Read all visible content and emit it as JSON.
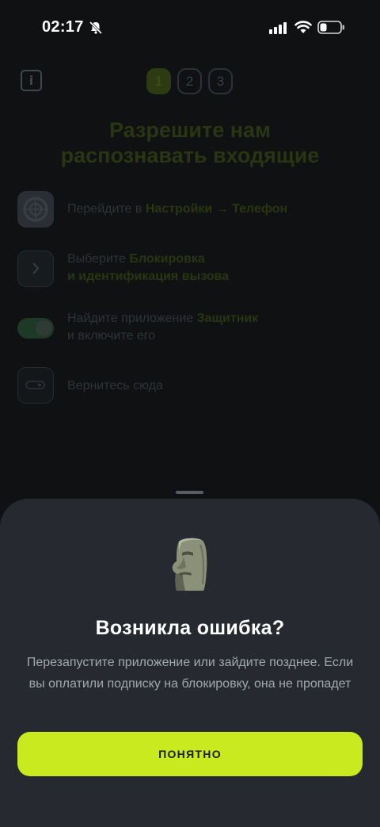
{
  "status_bar": {
    "time": "02:17",
    "icons": [
      "bell-slash-icon",
      "cellular-signal-icon",
      "wifi-icon",
      "battery-low-icon"
    ]
  },
  "background": {
    "info_icon": "info-icon",
    "steps": [
      "1",
      "2",
      "3"
    ],
    "active_step": "1",
    "title_line1": "Разрешите нам",
    "title_line2": "распознавать входящие",
    "instructions": [
      {
        "icon": "settings-icon",
        "text": "Перейдите в ",
        "bold": "Настройки → Телефон",
        "text2": ""
      },
      {
        "icon": "chevron-right-icon",
        "text": "Выберите ",
        "bold": "Блокировка",
        "bold2": "и идентификация вызова"
      },
      {
        "icon": "toggle-on-icon",
        "text": "Найдите приложение ",
        "bold": "Защитник",
        "text2": "и включите его"
      },
      {
        "icon": "back-card-icon",
        "text": "Вернитесь сюда"
      }
    ]
  },
  "sheet": {
    "emoji_icon": "moai-icon",
    "title": "Возникла ошибка?",
    "description": "Перезапустите приложение или зайдите позднее. Если вы оплатили подписку на блокировку, она не пропадет",
    "button_label": "ПОНЯТНО"
  },
  "colors": {
    "accent": "#c8ea1f",
    "sheet_background": "#262a30",
    "page_background": "#0f1113"
  }
}
